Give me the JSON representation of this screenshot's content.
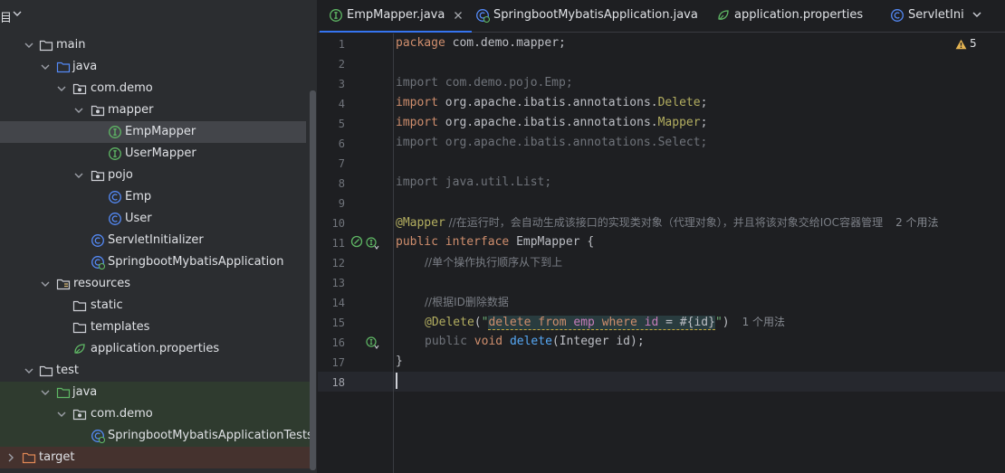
{
  "project_panel": {
    "header_label": "目",
    "items": [
      {
        "label": "main"
      },
      {
        "label": "java"
      },
      {
        "label": "com.demo"
      },
      {
        "label": "mapper"
      },
      {
        "label": "EmpMapper"
      },
      {
        "label": "UserMapper"
      },
      {
        "label": "pojo"
      },
      {
        "label": "Emp"
      },
      {
        "label": "User"
      },
      {
        "label": "ServletInitializer"
      },
      {
        "label": "SpringbootMybatisApplication"
      },
      {
        "label": "resources"
      },
      {
        "label": "static"
      },
      {
        "label": "templates"
      },
      {
        "label": "application.properties"
      },
      {
        "label": "test"
      },
      {
        "label": "java"
      },
      {
        "label": "com.demo"
      },
      {
        "label": "SpringbootMybatisApplicationTests"
      },
      {
        "label": "target"
      }
    ]
  },
  "tabs": [
    {
      "label": "EmpMapper.java",
      "icon": "interface-icon",
      "active": true
    },
    {
      "label": "SpringbootMybatisApplication.java",
      "icon": "spring-class-icon"
    },
    {
      "label": "application.properties",
      "icon": "spring-leaf-icon"
    },
    {
      "label": "ServletInit",
      "icon": "class-icon"
    }
  ],
  "editor": {
    "warning_count": "5",
    "line_numbers": [
      "1",
      "2",
      "3",
      "4",
      "5",
      "6",
      "7",
      "8",
      "9",
      "10",
      "11",
      "12",
      "13",
      "14",
      "15",
      "16",
      "17",
      "18"
    ],
    "code": {
      "l1_kw": "package",
      "l1_rest": " com.demo.mapper;",
      "l3": "import com.demo.pojo.Emp;",
      "l4_kw": "import",
      "l4_pkg": " org.apache.ibatis.annotations.",
      "l4_ann": "Delete",
      "l4_end": ";",
      "l5_kw": "import",
      "l5_pkg": " org.apache.ibatis.annotations.",
      "l5_ann": "Mapper",
      "l5_end": ";",
      "l6": "import org.apache.ibatis.annotations.Select;",
      "l8": "import java.util.List;",
      "l10_ann": "@Mapper",
      "l10_cmt": " //在运行时，会自动生成该接口的实现类对象（代理对象），并且将该对象交给IOC容器管理",
      "l10_hint": "2 个用法",
      "l11_kw1": "public",
      "l11_kw2": "interface",
      "l11_rest": " EmpMapper {",
      "l12_cmt": "//单个操作执行顺序从下到上",
      "l14_cmt": "//根据ID删除数据",
      "l15_ann": "@Delete",
      "l15_open": "(",
      "l15_q1": "\"",
      "l15_sql1": "delete",
      "l15_sql2": "from",
      "l15_sql3": "emp",
      "l15_sql4": "where",
      "l15_sql5": "id",
      "l15_sql6": " = #{id}",
      "l15_q2": "\"",
      "l15_close": ")",
      "l15_hint": "1 个用法",
      "l16_kw1": "public",
      "l16_kw2": "void",
      "l16_fn": "delete",
      "l16_rest": "(Integer id);",
      "l17": "}"
    }
  },
  "colors": {
    "background": "#1e1f22",
    "panel": "#2b2d30",
    "selection": "#43454a",
    "accent": "#3574f0",
    "keyword": "#cf8e6d",
    "annotation": "#b3ae60",
    "string": "#6aab73",
    "method": "#56a8f5",
    "interface_icon": "#5fb865",
    "class_icon": "#548af7"
  }
}
